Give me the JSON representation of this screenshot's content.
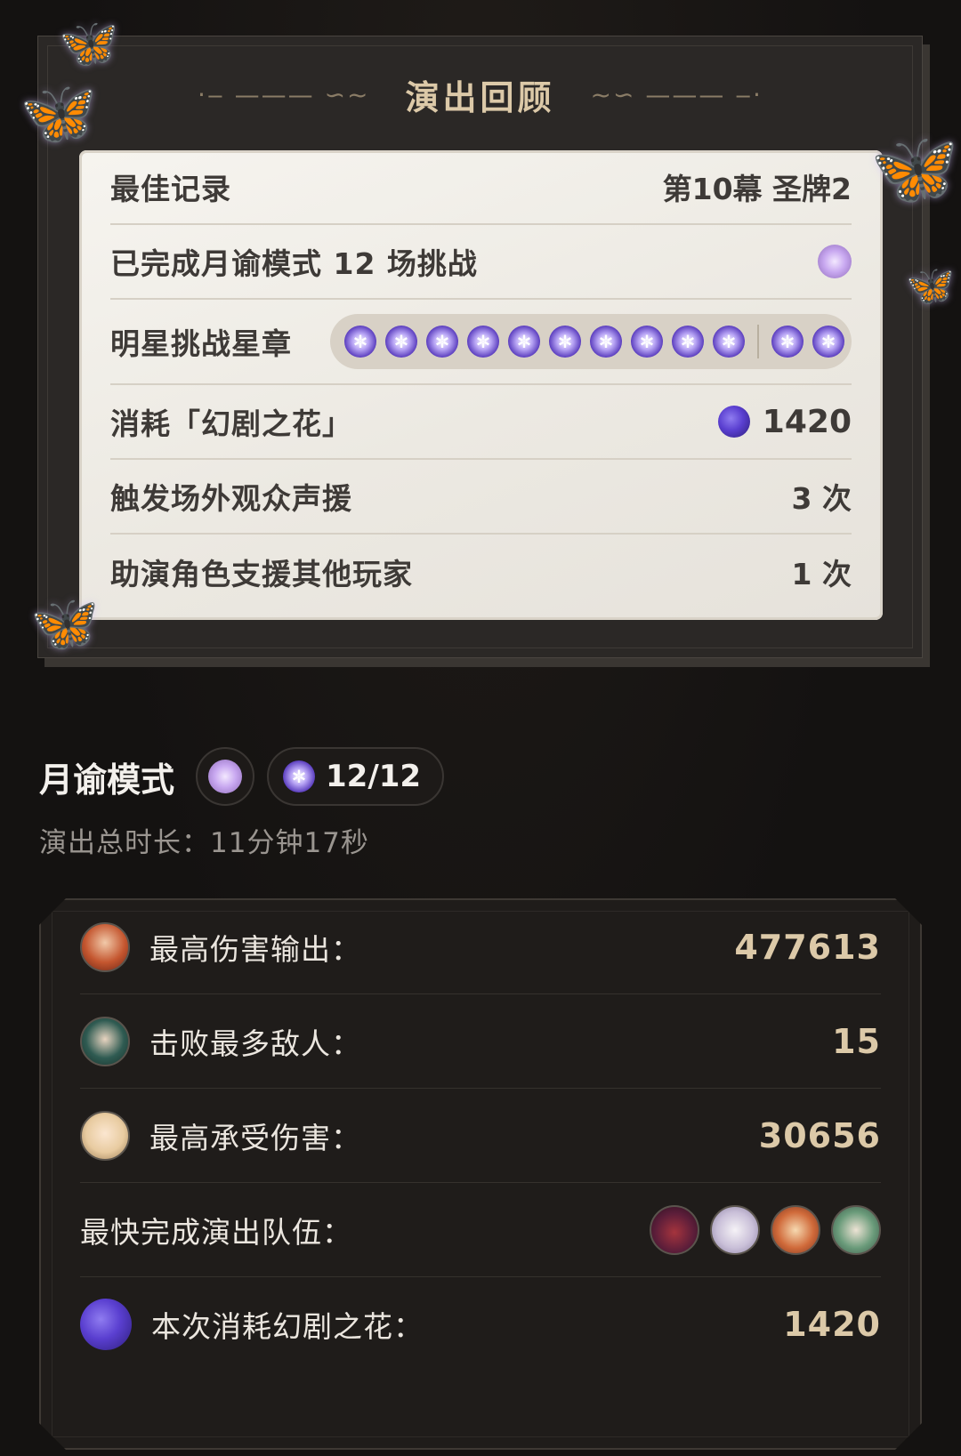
{
  "review": {
    "title": "演出回顾",
    "rows": {
      "best_record": {
        "label": "最佳记录",
        "value": "第10幕 圣牌2"
      },
      "completed": {
        "label": "已完成月谕模式 12 场挑战"
      },
      "star_badge": {
        "label": "明星挑战星章",
        "earned": 12,
        "total": 12
      },
      "flower_consumed": {
        "label": "消耗「幻剧之花」",
        "value": "1420"
      },
      "audience_support": {
        "label": "触发场外观众声援",
        "value": "3 次"
      },
      "support_others": {
        "label": "助演角色支援其他玩家",
        "value": "1 次"
      }
    }
  },
  "mode": {
    "title": "月谕模式",
    "progress": "12/12",
    "duration": "演出总时长：11分钟17秒"
  },
  "stats": {
    "highest_damage": {
      "label": "最高伤害输出：",
      "value": "477613"
    },
    "most_defeats": {
      "label": "击败最多敌人：",
      "value": "15"
    },
    "highest_taken": {
      "label": "最高承受伤害：",
      "value": "30656"
    },
    "fastest_team": {
      "label": "最快完成演出队伍："
    },
    "flower_spent": {
      "label": "本次消耗幻剧之花：",
      "value": "1420"
    }
  },
  "colors": {
    "background": "#141211",
    "gold_text": "#dcc9a8",
    "paper": "#f0ede7",
    "medal_purple": "#5c3fbf"
  },
  "icons": [
    "butterfly-icon",
    "trophy-icon",
    "star-medal-icon",
    "flower-icon",
    "character-avatar"
  ]
}
